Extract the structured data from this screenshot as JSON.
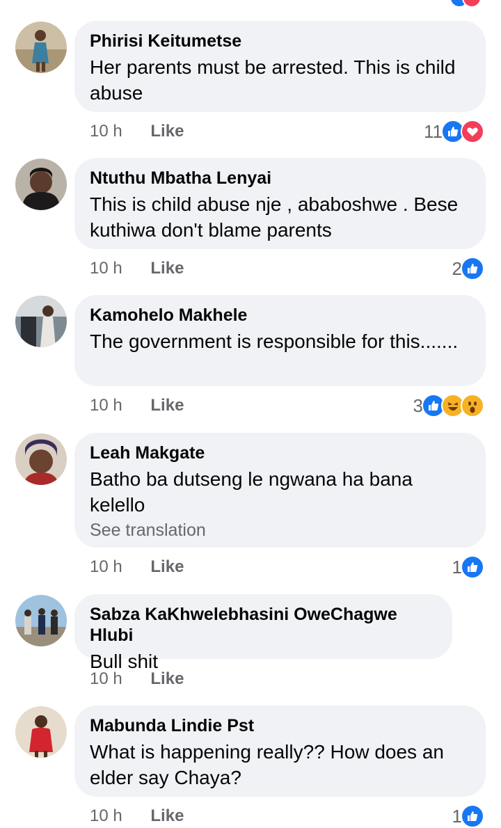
{
  "colors": {
    "like": "#1877f2",
    "love": "#f33e58",
    "haha": "#f7b125",
    "bubble": "#f0f2f5",
    "meta": "#65676b"
  },
  "labels": {
    "like": "Like",
    "see_translation": "See translation"
  },
  "comments": [
    {
      "author": "Phirisi Keitumetse",
      "text": "Her parents must be arrested. This is child abuse",
      "time": "10 h",
      "count": "11",
      "reactions": [
        "like-icon",
        "love-icon"
      ]
    },
    {
      "author": "Ntuthu Mbatha Lenyai",
      "text": "This is child abuse nje , ababoshwe . Bese kuthiwa don't blame parents",
      "time": "10 h",
      "count": "2",
      "reactions": [
        "like-icon"
      ]
    },
    {
      "author": "Kamohelo Makhele",
      "text": "The government is responsible for this.......",
      "time": "10 h",
      "count": "3",
      "reactions": [
        "like-icon",
        "haha-icon",
        "wow-icon"
      ]
    },
    {
      "author": "Leah Makgate",
      "text": "Batho ba dutseng  le ngwana ha bana kelello",
      "translate": "See translation",
      "time": "10 h",
      "count": "1",
      "reactions": [
        "like-icon"
      ]
    },
    {
      "author": "Sabza KaKhwelebhasini OweChagwe Hlubi",
      "text": "Bull shit",
      "time": "10 h",
      "count": "",
      "reactions": []
    },
    {
      "author": "Mabunda Lindie Pst",
      "text": "What is happening really?? How does an elder say Chaya?",
      "time": "10 h",
      "count": "1",
      "reactions": [
        "like-icon"
      ]
    }
  ]
}
